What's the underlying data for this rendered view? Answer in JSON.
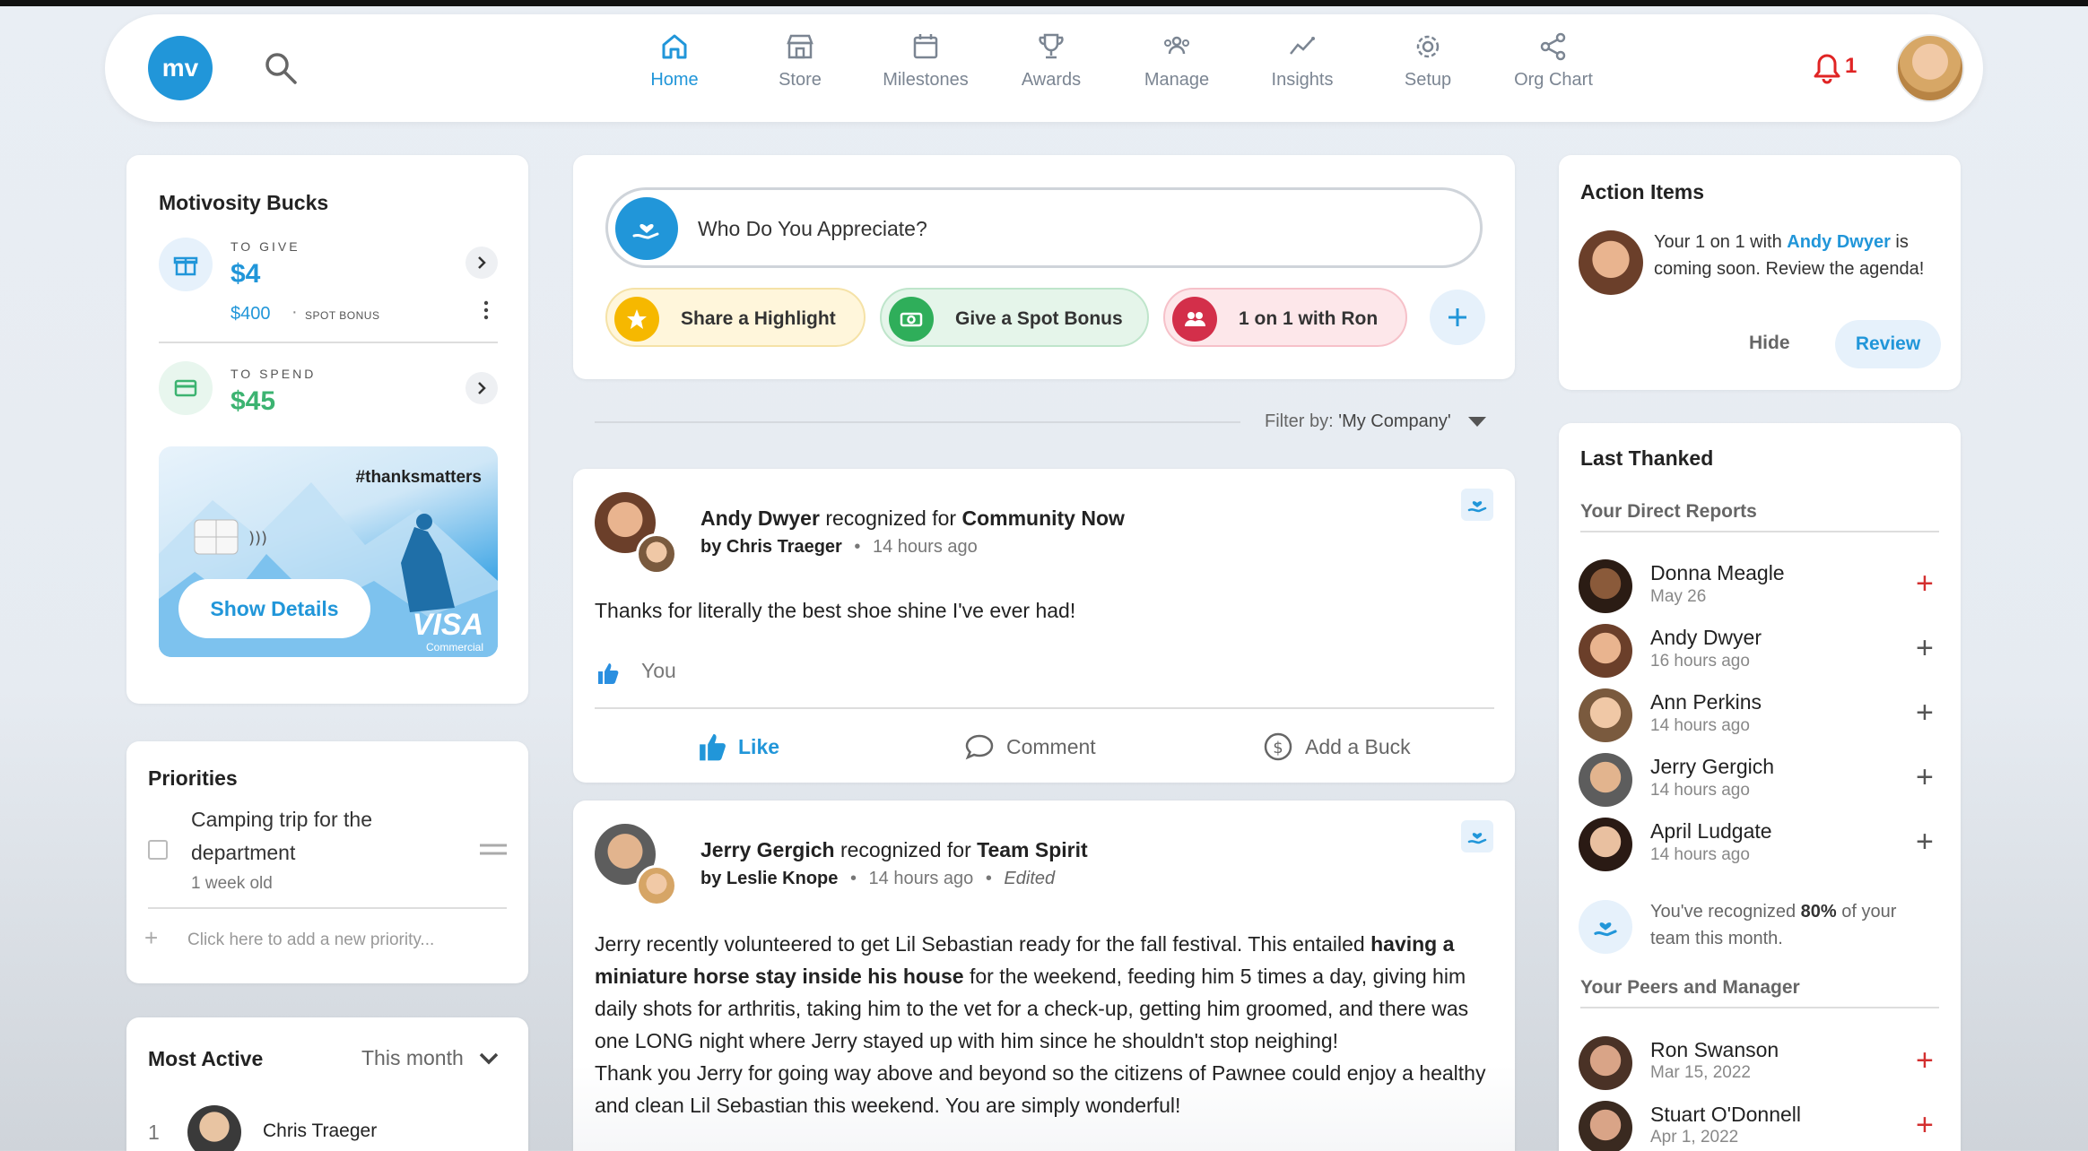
{
  "header": {
    "logo": "mv",
    "nav": [
      {
        "label": "Home",
        "icon": "home-icon",
        "active": true
      },
      {
        "label": "Store",
        "icon": "store-icon"
      },
      {
        "label": "Milestones",
        "icon": "calendar-icon"
      },
      {
        "label": "Awards",
        "icon": "trophy-icon"
      },
      {
        "label": "Manage",
        "icon": "people-icon"
      },
      {
        "label": "Insights",
        "icon": "insights-icon"
      },
      {
        "label": "Setup",
        "icon": "gear-icon"
      },
      {
        "label": "Org Chart",
        "icon": "share-icon"
      }
    ],
    "notifications": "1"
  },
  "bucks": {
    "title": "Motivosity Bucks",
    "to_give_label": "TO GIVE",
    "to_give_amount": "$4",
    "spot_amount": "$400",
    "spot_label": "SPOT BONUS",
    "to_spend_label": "TO SPEND",
    "to_spend_amount": "$45",
    "card_tag": "#thanksmatters",
    "card_brand": "VISA",
    "card_sub": "Commercial",
    "show_details": "Show Details"
  },
  "priorities": {
    "title": "Priorities",
    "item_text_line1": "Camping trip for the",
    "item_text_line2": "department",
    "item_age": "1 week old",
    "add_placeholder": "Click here to add a new priority..."
  },
  "most_active": {
    "title": "Most Active",
    "period": "This month",
    "rank": "1",
    "name": "Chris Traeger"
  },
  "compose": {
    "prompt": "Who Do You Appreciate?",
    "pills": [
      "Share a Highlight",
      "Give a Spot Bonus",
      "1 on 1 with Ron"
    ]
  },
  "filter": {
    "label": "Filter by:",
    "value": "'My Company'"
  },
  "posts": [
    {
      "recipient": "Andy Dwyer",
      "recognized_for": "recognized for",
      "value": "Community Now",
      "by": "by Chris Traeger",
      "time": "14 hours ago",
      "body": "Thanks for literally the best shoe shine I've ever had!",
      "likes": "You",
      "like": "Like",
      "comment": "Comment",
      "add_buck": "Add a Buck"
    },
    {
      "recipient": "Jerry Gergich",
      "recognized_for": "recognized for",
      "value": "Team Spirit",
      "by": "by Leslie Knope",
      "time": "14 hours ago",
      "edited": "Edited",
      "body_lines": [
        "Jerry recently volunteered to get Lil Sebastian ready for the fall festival. This entailed ",
        "having a miniature horse stay inside his house",
        " for the weekend, feeding him 5 times a day, giving him daily shots for arthritis, taking him to the vet for a check-up, getting him groomed, and there was one LONG night where Jerry stayed up with him since he shouldn't stop neighing!",
        "Thank you Jerry for going way above and beyond so the citizens of Pawnee could enjoy a healthy and clean Lil Sebastian this weekend. You are simply wonderful!"
      ]
    }
  ],
  "action_items": {
    "title": "Action Items",
    "text_pre": "Your 1 on 1 with ",
    "text_link": "Andy Dwyer",
    "text_post": " is coming soon. Review the agenda!",
    "hide": "Hide",
    "review": "Review"
  },
  "last_thanked": {
    "title": "Last Thanked",
    "direct_label": "Your Direct Reports",
    "direct": [
      {
        "name": "Donna Meagle",
        "date": "May 26",
        "plus_color": "#d32f2f"
      },
      {
        "name": "Andy Dwyer",
        "date": "16 hours ago",
        "plus_color": "#555555"
      },
      {
        "name": "Ann Perkins",
        "date": "14 hours ago",
        "plus_color": "#555555"
      },
      {
        "name": "Jerry Gergich",
        "date": "14 hours ago",
        "plus_color": "#555555"
      },
      {
        "name": "April Ludgate",
        "date": "14 hours ago",
        "plus_color": "#555555"
      }
    ],
    "summary_pre": "You've recognized ",
    "summary_pct": "80%",
    "summary_post": " of your team this month.",
    "peers_label": "Your Peers and Manager",
    "peers": [
      {
        "name": "Ron Swanson",
        "date": "Mar 15, 2022",
        "plus_color": "#d32f2f"
      },
      {
        "name": "Stuart O'Donnell",
        "date": "Apr 1, 2022",
        "plus_color": "#d32f2f"
      }
    ]
  },
  "colors": {
    "accent": "#2196d9",
    "green": "#3cb371",
    "red": "#e02424"
  }
}
